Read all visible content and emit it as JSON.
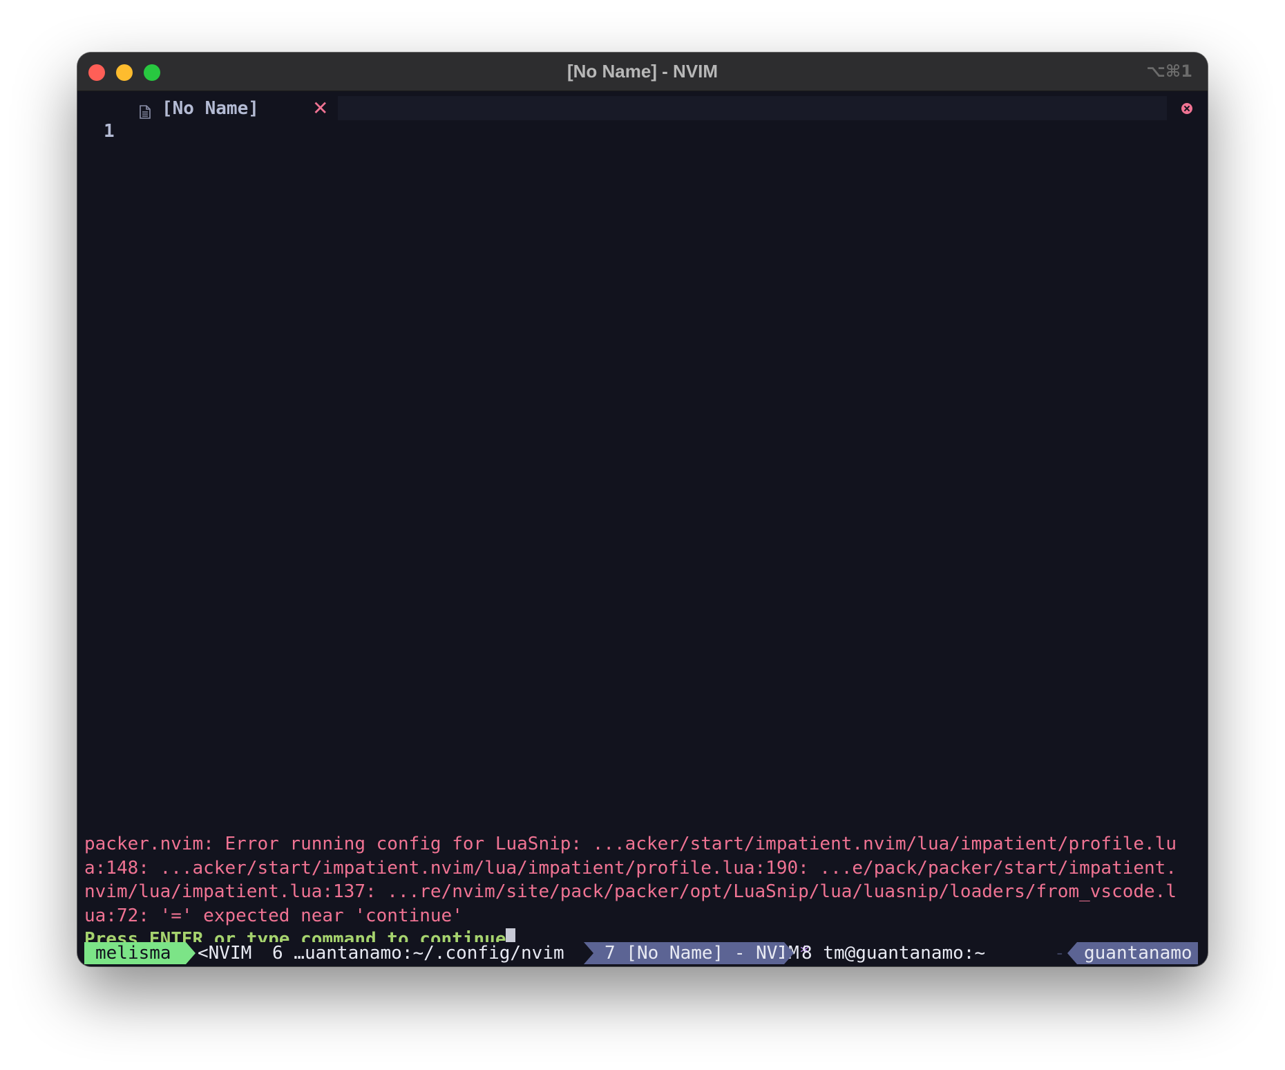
{
  "window": {
    "title": "[No Name] - NVIM",
    "shortcut": "⌥⌘1"
  },
  "tabline": {
    "tab_label": "[No Name]",
    "tab_close_glyph": "✕",
    "file_icon": "file-icon",
    "close_all_icon": "close-circle-icon"
  },
  "editor": {
    "line_numbers": [
      "1"
    ]
  },
  "messages": {
    "error_lines": [
      "packer.nvim: Error running config for LuaSnip: ...acker/start/impatient.nvim/lua/impatient/profile.lu",
      "a:148: ...acker/start/impatient.nvim/lua/impatient/profile.lua:190: ...e/pack/packer/start/impatient.",
      "nvim/lua/impatient.lua:137: ...re/nvim/site/pack/packer/opt/LuaSnip/lua/luasnip/loaders/from_vscode.l",
      "ua:72: '=' expected near 'continue'"
    ],
    "prompt": "Press ENTER or type command to continue"
  },
  "statusline": {
    "session": "melisma",
    "window_1": "<NVIM",
    "window_2": "6 …uantanamo:~/.config/nvim",
    "window_active": "7 [No Name] - NVIM",
    "active_flag": "*",
    "window_4": "8 tm@guantanamo:~",
    "hostname": "guantanamo"
  },
  "colors": {
    "background": "#12131e",
    "error": "#f07393",
    "prompt": "#a6d36e",
    "session_bg": "#7ce487",
    "active_tab_bg": "#5c6494"
  }
}
